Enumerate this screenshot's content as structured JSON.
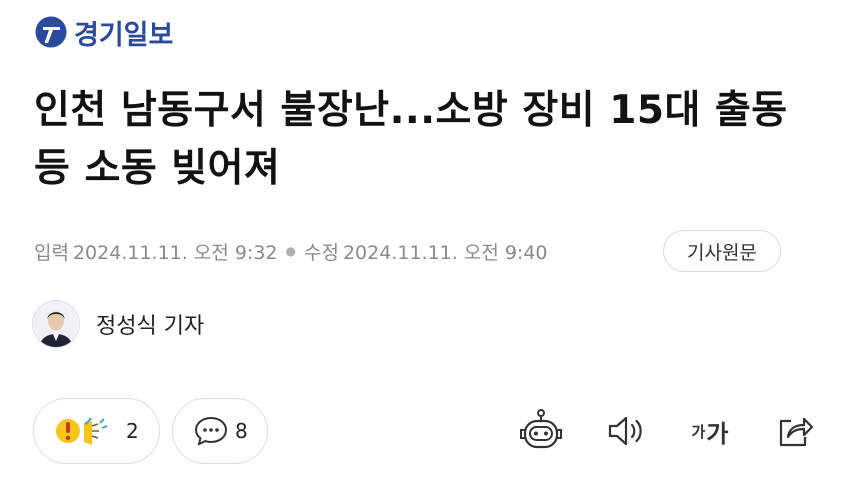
{
  "header": {
    "logo_text": "경기일보"
  },
  "article": {
    "headline": "인천 남동구서 불장난...소방 장비 15대 출동 등 소동 빚어져",
    "published_label": "입력",
    "published_value": "2024.11.11. 오전 9:32",
    "modified_label": "수정",
    "modified_value": "2024.11.11. 오전 9:40",
    "original_button": "기사원문",
    "author": "정성식 기자"
  },
  "reactions": {
    "reaction_count": "2",
    "comment_count": "8"
  },
  "toolbar": {
    "font_small": "가",
    "font_big": "가"
  },
  "colors": {
    "brand_blue": "#2a4a9c",
    "reaction_yellow": "#f5c518",
    "meta_gray": "#8a8a8a",
    "border_gray": "#dedede"
  },
  "icons": [
    "gyeonggi-ilbo-logo-icon",
    "reaction-emoji-icon",
    "comment-icon",
    "ai-robot-icon",
    "speaker-icon",
    "font-size-icon",
    "share-icon"
  ]
}
